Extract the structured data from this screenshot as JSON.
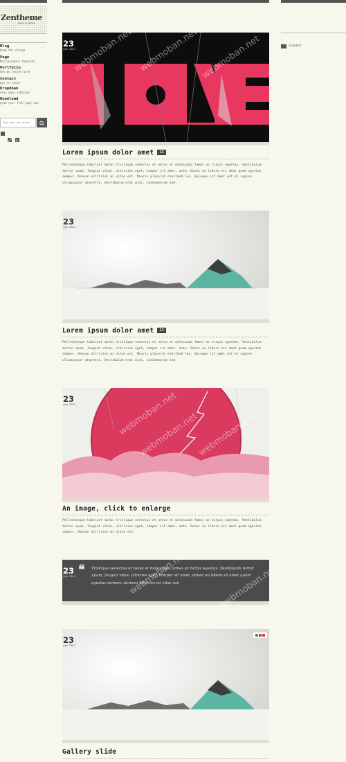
{
  "site": {
    "logo": "Zentheme",
    "tagline": "Less is more"
  },
  "nav": [
    {
      "title": "Blog",
      "sub": "Read the stream"
    },
    {
      "title": "Page",
      "sub": "Multipurpose template"
    },
    {
      "title": "Portfolio",
      "sub": "See my recent work"
    },
    {
      "title": "Contact",
      "sub": "get in touch"
    },
    {
      "title": "Dropdown",
      "sub": "have many subitems"
    },
    {
      "title": "Download",
      "sub": "grab your free copy now"
    }
  ],
  "search": {
    "placeholder": "Type and hit enter"
  },
  "social_icons": [
    "facebook-icon",
    "delicious-icon",
    "rss-icon"
  ],
  "right_sidebar": {
    "widget_label": "Sidebar"
  },
  "watermark": "webmoban.net",
  "posts": [
    {
      "day": "23",
      "month": "sep 2011",
      "title": "Lorem ipsum dolor amet",
      "comments": "13",
      "excerpt": "Pellentesque habitant morbi tristique senectus et netus et malesuada fames ac turpis egestas. Vestibulum tortor quam, feugiat vitae, ultricies eget, tempor sit amet, ante. Donec eu libero sit amet quam egestas semper. Aenean ultricies mi vitae est. Mauris placerat eleifend leo. Quisque sit amet est et sapien ullamcorper pharetra. Vestibulum erat wisi, condimentum sed."
    },
    {
      "day": "23",
      "month": "sep 2011",
      "title": "Lorem ipsum dolor amet",
      "comments": "13",
      "excerpt": "Pellentesque habitant morbi tristique senectus et netus et malesuada fames ac turpis egestas. Vestibulum tortor quam, feugiat vitae, ultricies eget, tempor sit amet, ante. Donec eu libero sit amet quam egestas semper. Aenean ultricies mi vitae est. Mauris placerat eleifend leo. Quisque sit amet est et sapien ullamcorper pharetra. Vestibulum erat wisi, condimentum sed."
    },
    {
      "day": "23",
      "month": "sep 2011",
      "title": "An image, click to enlarge",
      "excerpt": "Pellentesque habitant morbi tristique senectus et netus et malesuada fames ac turpis egestas. Vestibulum tortor quam, feugiat vitae, ultricies eget, tempor sit amet, ante. Donec eu libero sit amet quam egestas semper. Aenean ultricies mi vitae est."
    },
    {
      "day": "23",
      "month": "sep 2011",
      "quote": "Tristique senectus et netus et malesuada fames ac turpis egestas. Vestibulum tortor quam, feugiat vitae, ultricies eget, tempor sit amet, donec eu libero sit amet quam egestas semper. Aenean ultricies mi vitae est."
    },
    {
      "day": "23",
      "month": "sep 2011",
      "title": "Gallery slide"
    }
  ],
  "colors": {
    "background": "#f7f7ee",
    "accent_pink": "#e8385f",
    "dark": "#4b4b4b",
    "teal": "#5bb5a2"
  }
}
